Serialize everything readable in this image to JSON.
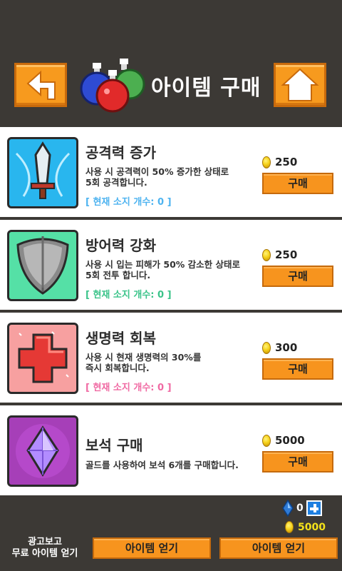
{
  "header": {
    "title": "아이템 구매",
    "back_icon": "back-arrow-icon",
    "home_icon": "home-icon",
    "potion_icon": "potions-icon"
  },
  "items": [
    {
      "title": "공격력 증가",
      "desc_line1": "사용 시 공격력이 50% 증가한 상태로",
      "desc_line2": "5회 공격합니다.",
      "owned": "[ 현재 소지 개수: 0 ]",
      "owned_color": "#4db3f0",
      "price": "250",
      "buy_label": "구매",
      "icon": "sword-icon",
      "icon_bg": "#29b6ee"
    },
    {
      "title": "방어력 강화",
      "desc_line1": "사용 시 입는 피해가 50% 감소한 상태로",
      "desc_line2": "5회 전투 합니다.",
      "owned": "[ 현재 소지 개수: 0 ]",
      "owned_color": "#3ac389",
      "price": "250",
      "buy_label": "구매",
      "icon": "shield-icon",
      "icon_bg": "#55e0a6"
    },
    {
      "title": "생명력 회복",
      "desc_line1": "사용 시 현재 생명력의 30%를",
      "desc_line2": "즉시 회복합니다.",
      "owned": "[ 현재 소지 개수: 0 ]",
      "owned_color": "#f06aa3",
      "price": "300",
      "buy_label": "구매",
      "icon": "health-cross-icon",
      "icon_bg": "#f7a0a0"
    },
    {
      "title": "보석 구매",
      "desc_line1": "골드를 사용하여 보석 6개를 구매합니다.",
      "desc_line2": "",
      "owned": "",
      "owned_color": "#333333",
      "price": "5000",
      "buy_label": "구매",
      "icon": "gem-icon",
      "icon_bg": "#a63fb8"
    }
  ],
  "footer": {
    "gem_count": "0",
    "gold_count": "5000",
    "ad_label_line1": "광고보고",
    "ad_label_line2": "무료 아이템 얻기",
    "get_item_1": "아이템 얻기",
    "get_item_2": "아이템 얻기"
  }
}
